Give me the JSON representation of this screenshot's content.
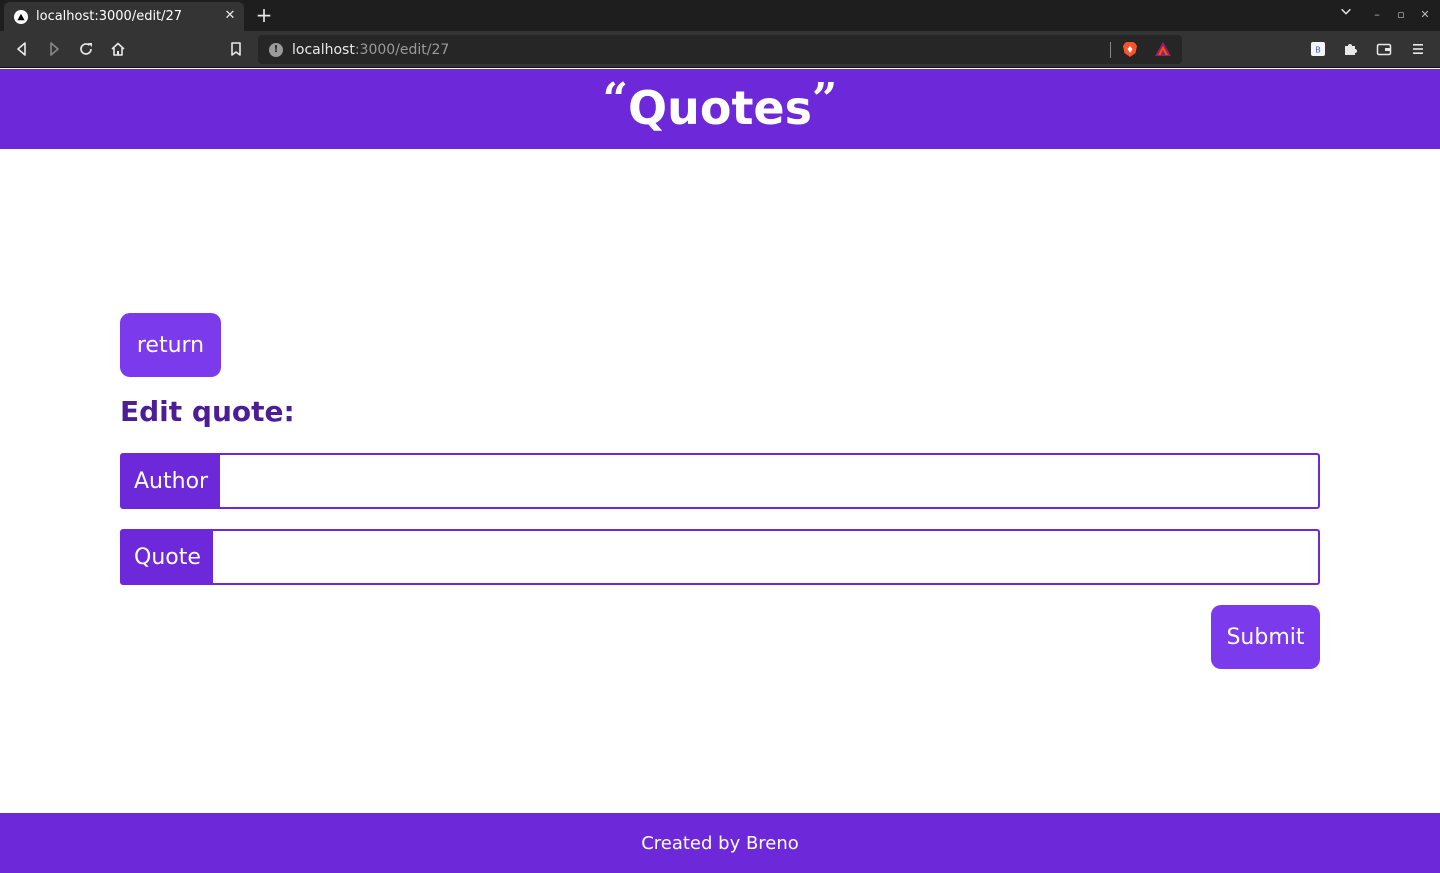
{
  "browser": {
    "tab_title": "localhost:3000/edit/27",
    "tab_close": "✕",
    "new_tab": "+",
    "url_host": "localhost",
    "url_path": ":3000/edit/27",
    "window_controls": [
      "–",
      "▫",
      "✕"
    ]
  },
  "header": {
    "open_quote": "“",
    "title": "Quotes",
    "close_quote": "”"
  },
  "main": {
    "return_label": "return",
    "heading": "Edit quote:",
    "author_label": "Author",
    "author_value": "",
    "quote_label": "Quote",
    "quote_value": "",
    "submit_label": "Submit"
  },
  "footer": {
    "text": "Created by Breno"
  },
  "colors": {
    "brand": "#6d28d9",
    "button": "#7c3aed",
    "heading": "#4c1d95"
  }
}
